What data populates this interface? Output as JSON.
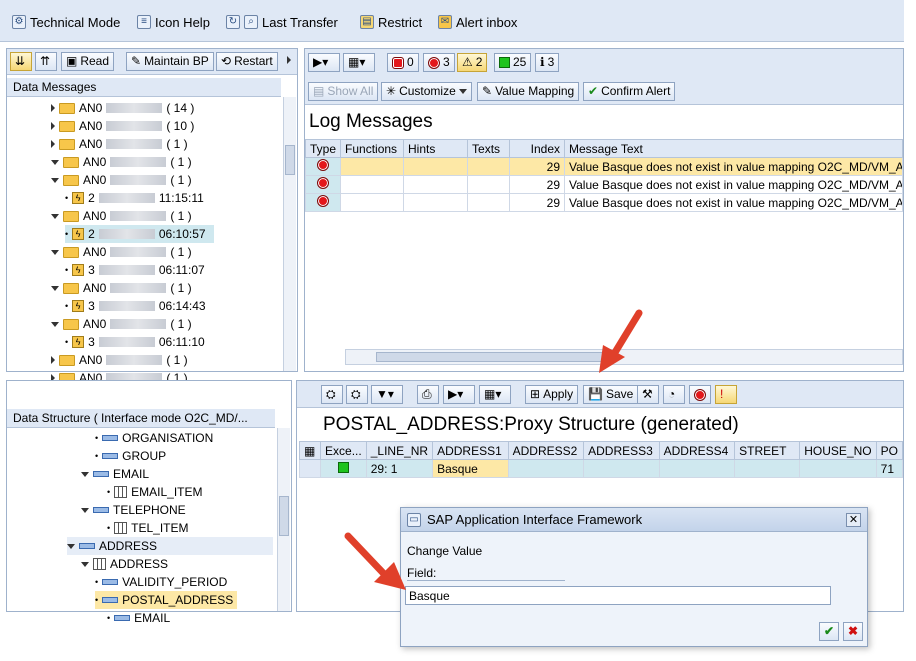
{
  "top_toolbar": [
    {
      "label": "Technical Mode",
      "icon": "technical-mode-icon"
    },
    {
      "label": "Icon Help",
      "icon": "icon-help-icon"
    },
    {
      "label": "Last Transfer",
      "icon": "last-transfer-icon"
    },
    {
      "label": "Restrict",
      "icon": "restrict-icon"
    },
    {
      "label": "Alert inbox",
      "icon": "alert-inbox-icon"
    }
  ],
  "left_toolbar": {
    "read": "Read",
    "maintain": "Maintain BP",
    "restart": "Restart"
  },
  "data_messages": {
    "header": "Data Messages",
    "rows": [
      {
        "prefix": "AN0",
        "suffix": "( 14 )"
      },
      {
        "prefix": "AN0",
        "suffix": "( 10 )"
      },
      {
        "prefix": "AN0",
        "suffix": "( 1 )"
      },
      {
        "prefix": "AN0",
        "suffix": "( 1 )"
      },
      {
        "prefix": "AN0",
        "suffix": "( 1 )"
      },
      {
        "prefix": "2",
        "suffix": "11:15:11"
      },
      {
        "prefix": "AN0",
        "suffix": "( 1 )"
      },
      {
        "prefix": "2",
        "suffix": "06:10:57"
      },
      {
        "prefix": "AN0",
        "suffix": "( 1 )"
      },
      {
        "prefix": "3",
        "suffix": "06:11:07"
      },
      {
        "prefix": "AN0",
        "suffix": "( 1 )"
      },
      {
        "prefix": "3",
        "suffix": "06:14:43"
      },
      {
        "prefix": "AN0",
        "suffix": "( 1 )"
      },
      {
        "prefix": "3",
        "suffix": "06:11:10"
      },
      {
        "prefix": "AN0",
        "suffix": "( 1 )"
      },
      {
        "prefix": "AN0",
        "suffix": "( 1 )"
      }
    ]
  },
  "log_toolbar": {
    "stop": "0",
    "red": "3",
    "warn": "2",
    "green": "25",
    "info": "3",
    "show_all": "Show All",
    "customize": "Customize",
    "value_mapping": "Value Mapping",
    "confirm_alert": "Confirm Alert"
  },
  "log": {
    "title": "Log Messages",
    "columns": [
      "Type",
      "Functions",
      "Hints",
      "Texts",
      "Index",
      "Message Text"
    ],
    "rows": [
      {
        "index": "29",
        "text": "Value Basque does not exist in value mapping O2C_MD/VM_A"
      },
      {
        "index": "29",
        "text": "Value Basque does not exist in value mapping O2C_MD/VM_A"
      },
      {
        "index": "29",
        "text": "Value Basque does not exist in value mapping O2C_MD/VM_A"
      }
    ]
  },
  "structure": {
    "header": "Data Structure ( Interface mode O2C_MD/...",
    "rows": [
      "ORGANISATION",
      "GROUP",
      "EMAIL",
      "EMAIL_ITEM",
      "TELEPHONE",
      "TEL_ITEM",
      "ADDRESS",
      "ADDRESS",
      "VALIDITY_PERIOD",
      "POSTAL_ADDRESS",
      "EMAIL"
    ]
  },
  "detail_toolbar": {
    "apply": "Apply",
    "save": "Save"
  },
  "detail": {
    "title": "POSTAL_ADDRESS:Proxy Structure (generated)",
    "columns": [
      "Exce...",
      "_LINE_NR",
      "ADDRESS1",
      "ADDRESS2",
      "ADDRESS3",
      "ADDRESS4",
      "STREET",
      "HOUSE_NO",
      "PO"
    ],
    "row": {
      "line_nr": "29: 1",
      "address1": "Basque",
      "po": "71"
    }
  },
  "dialog": {
    "title": "SAP Application Interface Framework",
    "change_value": "Change Value",
    "field_label": "Field:",
    "field_value": "Basque"
  },
  "colors": {
    "accent": "#dfe8f5",
    "highlight": "#fde8a6",
    "selected": "#cfe8ef",
    "arrow": "#e0402a"
  }
}
